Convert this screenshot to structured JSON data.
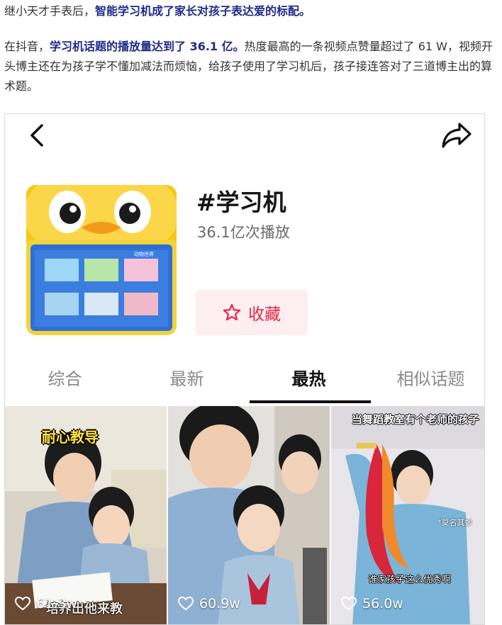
{
  "article": {
    "p1_plain": "继小天才手表后，",
    "p1_bold": "智能学习机成了家长对孩子表达爱的标配。",
    "p2_plain1": "在抖音，",
    "p2_bold": "学习机话题的播放量达到了 36.1 亿。",
    "p2_plain2": "热度最高的一条视频点赞量超过了 61 W，视频开头博主还在为孩子学不懂加减法而烦恼，给孩子使用了学习机后，孩子接连答对了三道博主出的算术题。"
  },
  "topic": {
    "title": "#学习机",
    "plays": "36.1亿次播放",
    "favorite_label": "收藏",
    "cover_screen_header": "动物世界"
  },
  "tabs": [
    "综合",
    "最新",
    "最热",
    "相似话题"
  ],
  "active_tab_index": 2,
  "videos": [
    {
      "likes": "61.3w",
      "caption_top": "耐心教导",
      "caption_bottom": "培养出他来教"
    },
    {
      "likes": "60.9w"
    },
    {
      "likes": "56.0w",
      "caption_top": "当舞蹈教室有个老师的孩子",
      "caption_side": "*莫名其妙",
      "caption_mid": "谁家孩子这么优秀啊"
    }
  ],
  "colors": {
    "accent_red": "#e8264a",
    "fav_bg": "#fdeef1",
    "bold_text": "#1f2a8a"
  },
  "icons": [
    "back-arrow-icon",
    "share-arrow-icon",
    "star-icon",
    "heart-icon"
  ]
}
